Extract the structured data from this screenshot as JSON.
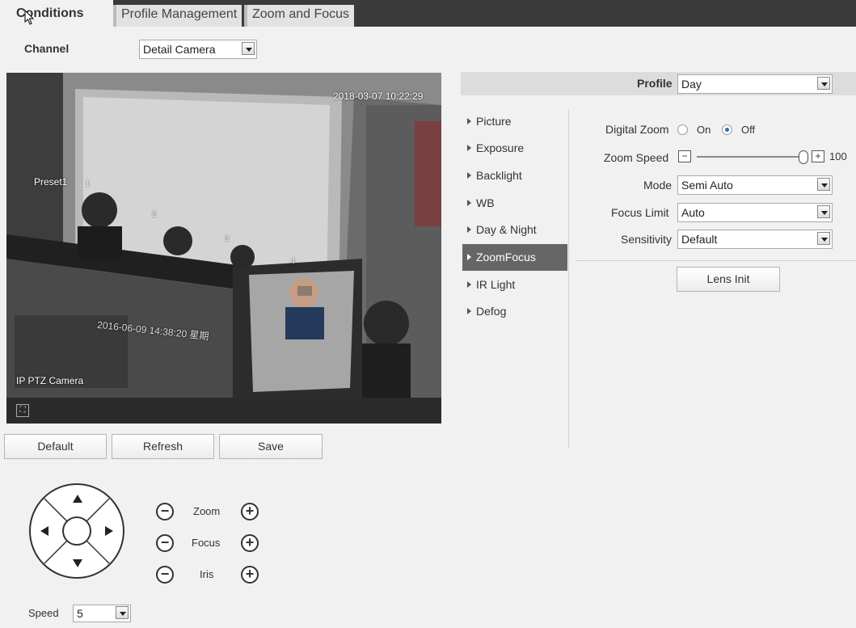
{
  "tabs": [
    {
      "label": "Conditions"
    },
    {
      "label": "Profile Management"
    },
    {
      "label": "Zoom and Focus"
    }
  ],
  "channel": {
    "label": "Channel",
    "value": "Detail Camera"
  },
  "video": {
    "timestamp_main": "2018-03-07 10:22:29",
    "preset_label": "Preset1",
    "inner_timestamp": "2016-06-09 14:38:20 星期",
    "camera_label": "IP PTZ Camera",
    "markers": [
      "1",
      "2",
      "3",
      "4"
    ]
  },
  "actions": {
    "default": "Default",
    "refresh": "Refresh",
    "save": "Save"
  },
  "ptz": {
    "zoom_label": "Zoom",
    "focus_label": "Focus",
    "iris_label": "Iris",
    "speed_label": "Speed",
    "speed_value": "5",
    "minus": "−",
    "plus": "+"
  },
  "profile": {
    "label": "Profile",
    "value": "Day"
  },
  "menu": [
    {
      "label": "Picture"
    },
    {
      "label": "Exposure"
    },
    {
      "label": "Backlight"
    },
    {
      "label": "WB"
    },
    {
      "label": "Day & Night"
    },
    {
      "label": "ZoomFocus"
    },
    {
      "label": "IR Light"
    },
    {
      "label": "Defog"
    }
  ],
  "settings": {
    "digital_zoom_label": "Digital Zoom",
    "on_label": "On",
    "off_label": "Off",
    "zoom_speed_label": "Zoom Speed",
    "zoom_speed_value": "100",
    "mode_label": "Mode",
    "mode_value": "Semi Auto",
    "focus_limit_label": "Focus Limit",
    "focus_limit_value": "Auto",
    "sensitivity_label": "Sensitivity",
    "sensitivity_value": "Default",
    "lens_init": "Lens Init"
  }
}
